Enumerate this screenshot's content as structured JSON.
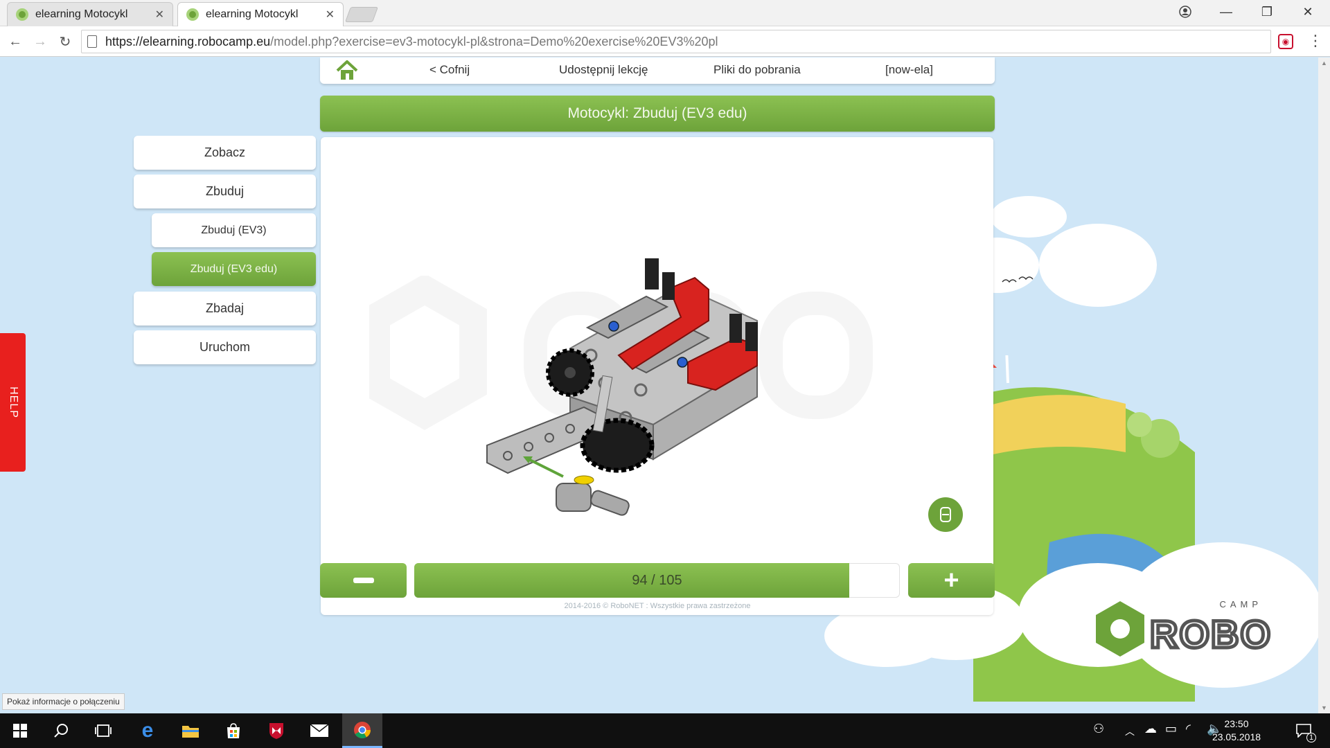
{
  "browser": {
    "tabs": [
      {
        "title": "elearning Motocykl",
        "active": false
      },
      {
        "title": "elearning Motocykl",
        "active": true
      }
    ],
    "url_host": "https://elearning.robocamp.eu",
    "url_path": "/model.php?exercise=ev3-motocykl-pl&strona=Demo%20exercise%20EV3%20pl",
    "status_text": "Pokaż informacje o połączeniu"
  },
  "top_menu": {
    "back": "< Cofnij",
    "share": "Udostępnij lekcję",
    "downloads": "Pliki do pobrania",
    "user": "[now-ela]"
  },
  "title": "Motocykl: Zbuduj (EV3 edu)",
  "sidebar": {
    "items": [
      {
        "label": "Zobacz",
        "level": "main",
        "active": false
      },
      {
        "label": "Zbuduj",
        "level": "main",
        "active": false
      },
      {
        "label": "Zbuduj (EV3)",
        "level": "sub",
        "active": false
      },
      {
        "label": "Zbuduj (EV3 edu)",
        "level": "sub",
        "active": true
      },
      {
        "label": "Zbadaj",
        "level": "main",
        "active": false
      },
      {
        "label": "Uruchom",
        "level": "main",
        "active": false
      }
    ]
  },
  "help_label": "HELP",
  "step": {
    "current": 94,
    "total": 105,
    "label": "94 / 105"
  },
  "footer": "2014-2016 © RoboNET : Wszystkie prawa zastrzeżone",
  "logo": {
    "small": "CAMP",
    "large": "ROBO"
  },
  "taskbar": {
    "time": "23:50",
    "date": "23.05.2018",
    "notifications": "1"
  },
  "colors": {
    "accent_green": "#6da33a",
    "accent_green_light": "#8cc152",
    "help_red": "#e8201e",
    "sky": "#cfe6f7"
  }
}
